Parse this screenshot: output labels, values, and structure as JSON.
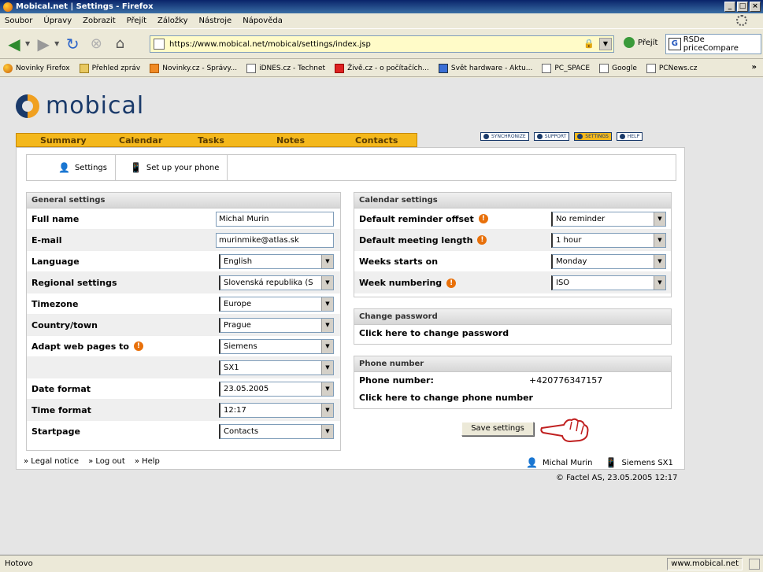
{
  "window": {
    "title": "Mobical.net | Settings - Firefox",
    "buttons": [
      "_",
      "□",
      "×"
    ]
  },
  "menu": [
    "Soubor",
    "Úpravy",
    "Zobrazit",
    "Přejít",
    "Záložky",
    "Nástroje",
    "Nápověda"
  ],
  "nav": {
    "url": "https://www.mobical.net/mobical/settings/index.jsp",
    "go_label": "Přejít",
    "search_text": "RSDe priceCompare"
  },
  "bookmarks": [
    {
      "label": "Novinky Firefox",
      "icon": "firefox-icon"
    },
    {
      "label": "Přehled zpráv",
      "icon": "folder-icon"
    },
    {
      "label": "Novinky.cz - Správy...",
      "icon": "rss-icon"
    },
    {
      "label": "iDNES.cz - Technet",
      "icon": "page-icon"
    },
    {
      "label": "Živě.cz - o počítačích...",
      "icon": "red-icon"
    },
    {
      "label": "Svět hardware - Aktu...",
      "icon": "blue-icon"
    },
    {
      "label": "PC_SPACE",
      "icon": "page-icon"
    },
    {
      "label": "Google",
      "icon": "page-icon"
    },
    {
      "label": "PCNews.cz",
      "icon": "page-icon"
    }
  ],
  "logo_text": "mobical",
  "tabs": [
    "Summary",
    "Calendar",
    "Tasks",
    "Notes",
    "Contacts"
  ],
  "top_links": [
    {
      "label": "SYNCHRONIZE",
      "active": false
    },
    {
      "label": "SUPPORT",
      "active": false
    },
    {
      "label": "SETTINGS",
      "active": true
    },
    {
      "label": "HELP",
      "active": false
    }
  ],
  "subtabs": [
    "Settings",
    "Set up your phone"
  ],
  "general": {
    "title": "General settings",
    "full_name_label": "Full name",
    "full_name_value": "Michal Murin",
    "email_label": "E-mail",
    "email_value": "murinmike@atlas.sk",
    "language_label": "Language",
    "language_value": "English",
    "regional_label": "Regional settings",
    "regional_value": "Slovenská republika (S",
    "timezone_label": "Timezone",
    "timezone_value": "Europe",
    "country_label": "Country/town",
    "country_value": "Prague",
    "adapt_label": "Adapt web pages to",
    "adapt_value": "Siemens",
    "adapt_model_value": "SX1",
    "date_label": "Date format",
    "date_value": "23.05.2005",
    "time_label": "Time format",
    "time_value": "12:17",
    "startpage_label": "Startpage",
    "startpage_value": "Contacts"
  },
  "calendar": {
    "title": "Calendar settings",
    "reminder_label": "Default reminder offset",
    "reminder_value": "No reminder",
    "meeting_label": "Default meeting length",
    "meeting_value": "1 hour",
    "weekstart_label": "Weeks starts on",
    "weekstart_value": "Monday",
    "weeknum_label": "Week numbering",
    "weeknum_value": "ISO"
  },
  "password": {
    "title": "Change password",
    "link": "Click here to change password"
  },
  "phone": {
    "title": "Phone number",
    "number_label": "Phone number:",
    "number_value": "+420776347157",
    "link": "Click here to change phone number"
  },
  "save_label": "Save settings",
  "footer": [
    "Legal notice",
    "Log out",
    "Help"
  ],
  "user": {
    "name": "Michal Murin",
    "phone": "Siemens SX1"
  },
  "copyright": "© Factel AS, 23.05.2005 12:17",
  "status": {
    "left": "Hotovo",
    "right": "www.mobical.net"
  }
}
